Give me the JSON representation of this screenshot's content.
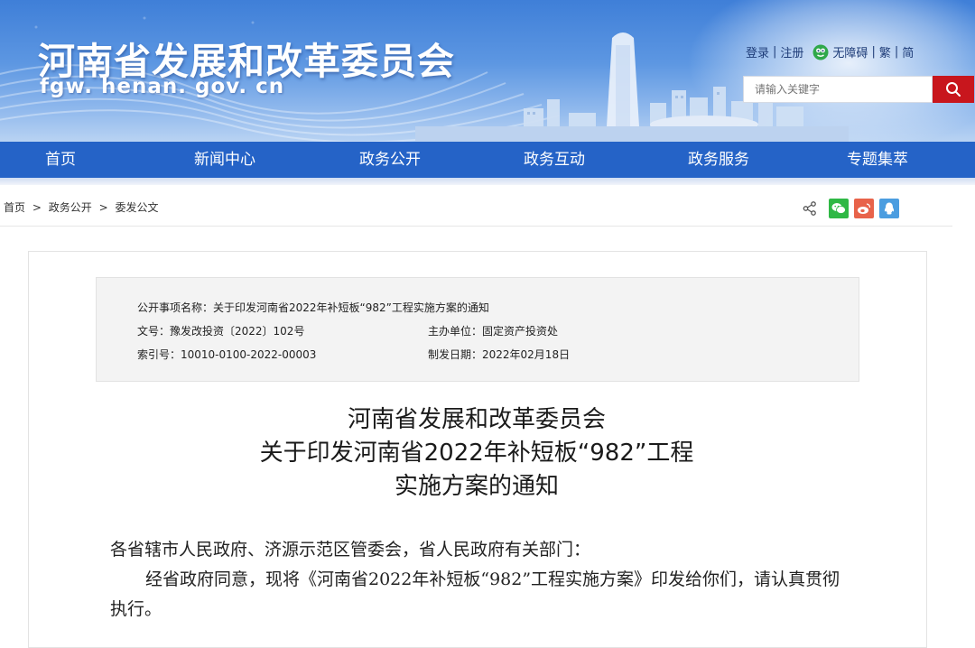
{
  "header": {
    "site_title": "河南省发展和改革委员会",
    "site_domain": "fgw. henan. gov. cn",
    "links": {
      "login": "登录",
      "register": "注册",
      "accessibility": "无障碍",
      "traditional": "繁",
      "simplified": "简"
    },
    "search": {
      "placeholder": "请输入关键字"
    }
  },
  "nav": {
    "items": [
      {
        "label": "首页"
      },
      {
        "label": "新闻中心"
      },
      {
        "label": "政务公开"
      },
      {
        "label": "政务互动"
      },
      {
        "label": "政务服务"
      },
      {
        "label": "专题集萃"
      }
    ]
  },
  "breadcrumb": {
    "items": [
      "首页",
      "政务公开",
      "委发公文"
    ],
    "separator": ">"
  },
  "share": {
    "icons": [
      "share-icon",
      "wechat-icon",
      "weibo-icon",
      "qq-icon"
    ],
    "colors": {
      "wechat": "#2fb845",
      "weibo": "#e8634a",
      "qq": "#4b9de0"
    }
  },
  "info": {
    "item_name": "公开事项名称：关于印发河南省2022年补短板“982”工程实施方案的通知",
    "doc_number": "文号：豫发改投资〔2022〕102号",
    "host_unit": "主办单位：固定资产投资处",
    "index_number": "索引号：10010-0100-2022-00003",
    "issue_date": "制发日期：2022年02月18日"
  },
  "document": {
    "title_lines": [
      "河南省发展和改革委员会",
      "关于印发河南省2022年补短板“982”工程",
      "实施方案的通知"
    ],
    "salutation": "各省辖市人民政府、济源示范区管委会，省人民政府有关部门：",
    "paragraph_line1": "经省政府同意，现将《河南省2022年补短板“982”工程实施方案》印发给你们，请认真贯彻",
    "paragraph_line2": "执行。"
  },
  "colors": {
    "nav_bg": "#2563c7",
    "search_button": "#c8161d",
    "header_blue": "#3f7fd8"
  }
}
